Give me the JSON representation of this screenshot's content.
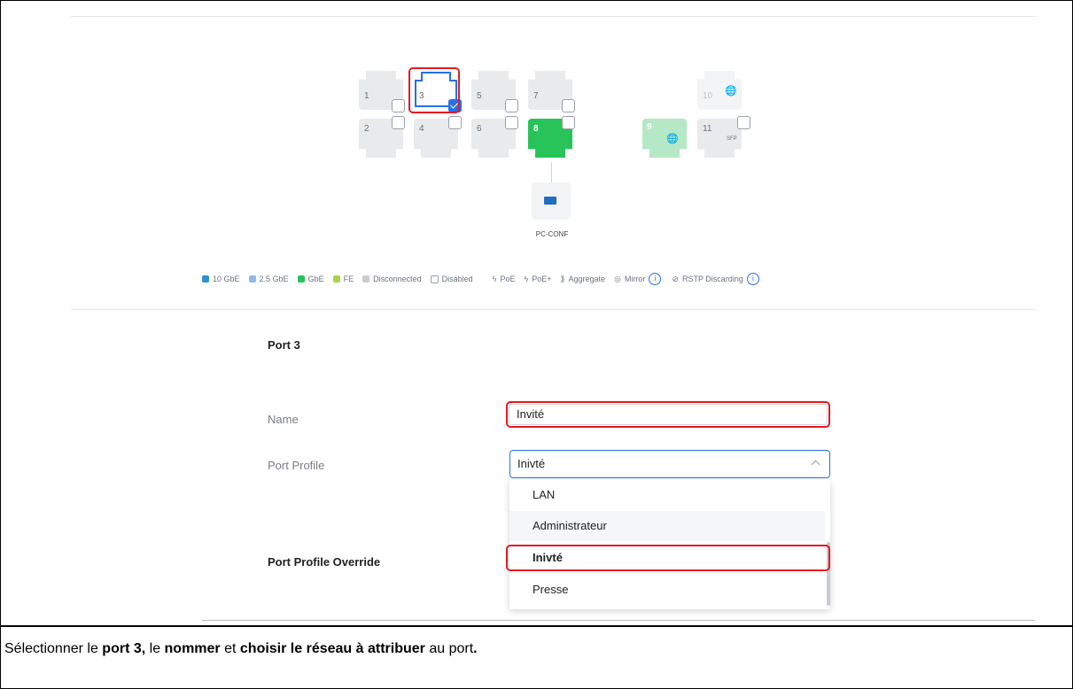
{
  "ports": {
    "top": [
      {
        "num": "1",
        "state": "disconnected"
      },
      {
        "num": "3",
        "state": "selected"
      },
      {
        "num": "5",
        "state": "disconnected"
      },
      {
        "num": "7",
        "state": "disconnected"
      },
      {
        "num": "10",
        "state": "disabled"
      }
    ],
    "bottom": [
      {
        "num": "2",
        "state": "disconnected"
      },
      {
        "num": "4",
        "state": "disconnected"
      },
      {
        "num": "6",
        "state": "disconnected"
      },
      {
        "num": "8",
        "state": "connected-gbe"
      },
      {
        "num": "9",
        "state": "uplink"
      },
      {
        "num": "11",
        "state": "sfp",
        "sub": "SFP"
      }
    ]
  },
  "device": {
    "name": "PC-CONF"
  },
  "legend": {
    "speeds": [
      {
        "label": "10 GbE",
        "color": "#2f8fd0"
      },
      {
        "label": "2.5 GbE",
        "color": "#8fb8ee"
      },
      {
        "label": "GbE",
        "color": "#28c45a"
      },
      {
        "label": "FE",
        "color": "#a6d64a"
      },
      {
        "label": "Disconnected",
        "color": "#c9ccd1"
      },
      {
        "label": "Disabled",
        "color": "#ffffff"
      }
    ],
    "poe": "PoE",
    "poe_plus": "PoE+",
    "aggregate": "Aggregate",
    "mirror": "Mirror",
    "rstp": "RSTP Discarding",
    "info_glyph": "i"
  },
  "form": {
    "title": "Port 3",
    "name_label": "Name",
    "name_value": "Invité",
    "profile_label": "Port Profile",
    "profile_value": "Inivté",
    "override_label": "Port Profile Override",
    "options": [
      "LAN",
      "Administrateur",
      "Inivté",
      "Presse"
    ]
  },
  "caption": {
    "pre1": "Sélectionner le ",
    "b1": "port 3,",
    "pre2": " le ",
    "b2": "nommer",
    "pre3": " et ",
    "b3": "choisir le réseau à attribuer",
    "pre4": " au port",
    "b4": "."
  },
  "colors": {
    "accent": "#2670e8",
    "highlight": "#e31b23",
    "connected": "#28c45a"
  }
}
